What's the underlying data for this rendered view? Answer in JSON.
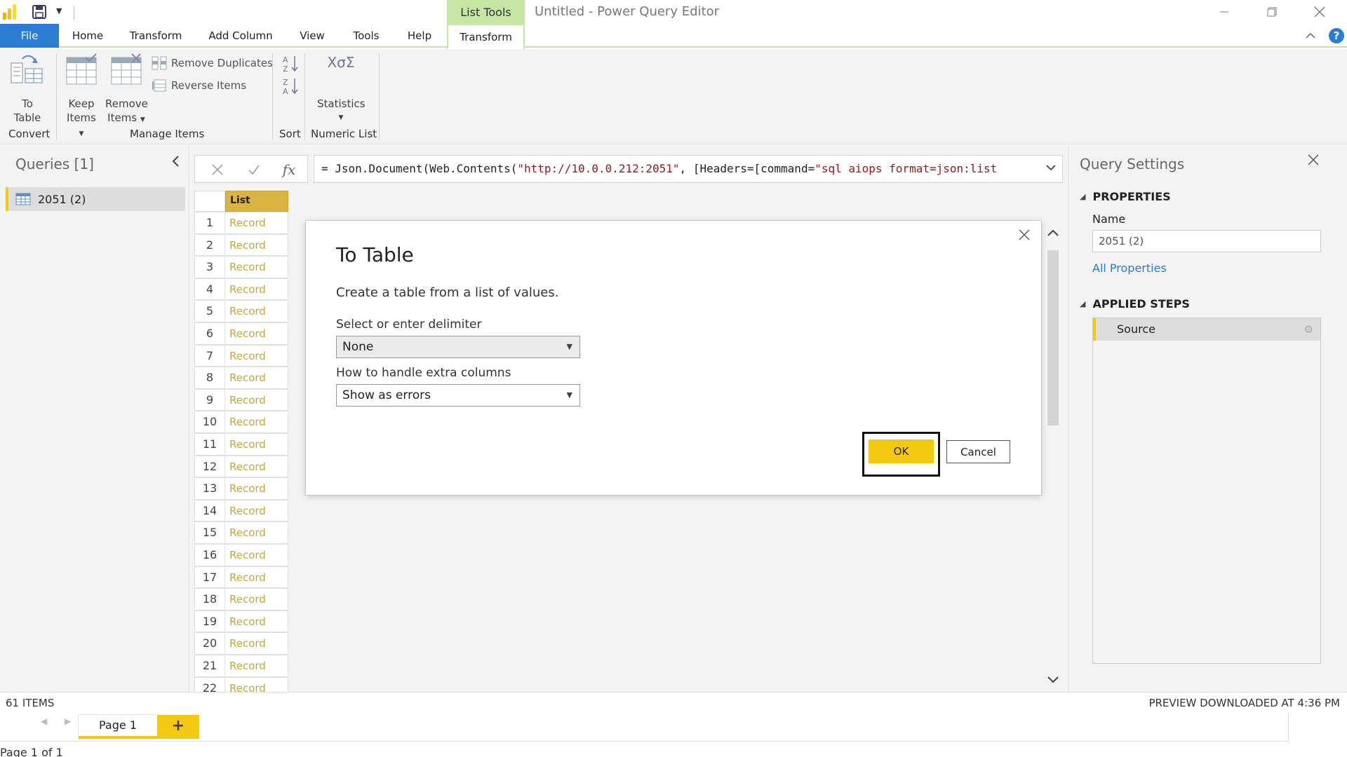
{
  "titlebar": {
    "context_tab": "List Tools",
    "app_title": "Untitled - Power Query Editor"
  },
  "tabs": {
    "file": "File",
    "home": "Home",
    "transform": "Transform",
    "add_column": "Add Column",
    "view": "View",
    "tools": "Tools",
    "help": "Help",
    "transform_ctx": "Transform",
    "help_icon": "?"
  },
  "ribbon": {
    "to_table_line1": "To",
    "to_table_line2": "Table",
    "keep_items_line1": "Keep",
    "keep_items_line2": "Items",
    "remove_items_line1": "Remove",
    "remove_items_line2": "Items",
    "remove_duplicates": "Remove Duplicates",
    "reverse_items": "Reverse Items",
    "statistics": "Statistics",
    "statistics_glyph_top": "XσΣ",
    "groups": {
      "convert": "Convert",
      "manage_items": "Manage Items",
      "sort": "Sort",
      "numeric_list": "Numeric List"
    }
  },
  "queries": {
    "title": "Queries [1]",
    "items": [
      {
        "label": "2051 (2)"
      }
    ]
  },
  "formula_bar": {
    "fx_label": "fx",
    "prefix": "= Json.Document(Web.Contents(",
    "url": "\"http://10.0.0.212:2051\"",
    "middle": ", [Headers=[command=",
    "command": "\"sql aiops format=json:list"
  },
  "grid": {
    "column_header": "List",
    "rows": [
      {
        "n": "1",
        "v": "Record"
      },
      {
        "n": "2",
        "v": "Record"
      },
      {
        "n": "3",
        "v": "Record"
      },
      {
        "n": "4",
        "v": "Record"
      },
      {
        "n": "5",
        "v": "Record"
      },
      {
        "n": "6",
        "v": "Record"
      },
      {
        "n": "7",
        "v": "Record"
      },
      {
        "n": "8",
        "v": "Record"
      },
      {
        "n": "9",
        "v": "Record"
      },
      {
        "n": "10",
        "v": "Record"
      },
      {
        "n": "11",
        "v": "Record"
      },
      {
        "n": "12",
        "v": "Record"
      },
      {
        "n": "13",
        "v": "Record"
      },
      {
        "n": "14",
        "v": "Record"
      },
      {
        "n": "15",
        "v": "Record"
      },
      {
        "n": "16",
        "v": "Record"
      },
      {
        "n": "17",
        "v": "Record"
      },
      {
        "n": "18",
        "v": "Record"
      },
      {
        "n": "19",
        "v": "Record"
      },
      {
        "n": "20",
        "v": "Record"
      },
      {
        "n": "21",
        "v": "Record"
      },
      {
        "n": "22",
        "v": "Record"
      }
    ]
  },
  "settings": {
    "title": "Query Settings",
    "properties_title": "PROPERTIES",
    "name_label": "Name",
    "name_value": "2051 (2)",
    "all_properties": "All Properties",
    "applied_steps_title": "APPLIED STEPS",
    "steps": [
      {
        "label": "Source"
      }
    ]
  },
  "statusbar": {
    "items_count": "61 ITEMS",
    "preview_status": "PREVIEW DOWNLOADED AT 4:36 PM",
    "page_tab": "Page 1",
    "add_page": "+",
    "page_of": "Page 1 of 1"
  },
  "dialog": {
    "title": "To Table",
    "description": "Create a table from a list of values.",
    "delimiter_label": "Select or enter delimiter",
    "delimiter_value": "None",
    "extra_columns_label": "How to handle extra columns",
    "extra_columns_value": "Show as errors",
    "ok_label": "OK",
    "cancel_label": "Cancel"
  },
  "colors": {
    "accent_blue": "#2b7cd3",
    "accent_yellow": "#f2c811",
    "context_green": "#c7e6a3",
    "column_header_gold": "#dbb341",
    "record_text": "#c9a53a"
  }
}
